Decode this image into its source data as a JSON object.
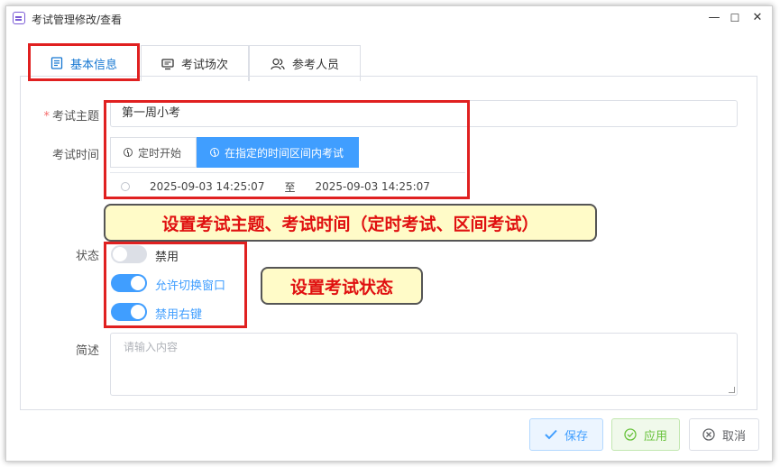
{
  "window": {
    "title": "考试管理修改/查看",
    "minimize_icon": "minimize-icon",
    "maximize_icon": "maximize-icon",
    "close_icon": "close-icon"
  },
  "tabs": [
    {
      "label": "基本信息",
      "icon": "document-list-icon",
      "active": true
    },
    {
      "label": "考试场次",
      "icon": "monitor-icon",
      "active": false
    },
    {
      "label": "参考人员",
      "icon": "users-icon",
      "active": false
    }
  ],
  "form": {
    "subject_label": "考试主题",
    "subject_required": "*",
    "subject_value": "第一周小考",
    "time_label": "考试时间",
    "time_modes": [
      {
        "label": "定时开始",
        "active": false
      },
      {
        "label": "在指定的时间区间内考试",
        "active": true
      }
    ],
    "range_start": "2025-09-03 14:25:07",
    "range_separator": "至",
    "range_end": "2025-09-03 14:25:07",
    "status_label": "状态",
    "switches": [
      {
        "label": "禁用",
        "on": false
      },
      {
        "label": "允许切换窗口",
        "on": true
      },
      {
        "label": "禁用右键",
        "on": true
      }
    ],
    "desc_label": "简述",
    "desc_placeholder": "请输入内容"
  },
  "footer": {
    "save_label": "保存",
    "apply_label": "应用",
    "cancel_label": "取消"
  },
  "annotations": {
    "callout_subject_time": "设置考试主题、考试时间（定时考试、区间考试）",
    "callout_status": "设置考试状态"
  },
  "colors": {
    "primary": "#409eff",
    "success": "#67c23a",
    "annotation_red": "#e02020",
    "callout_bg": "#fffbc8"
  }
}
